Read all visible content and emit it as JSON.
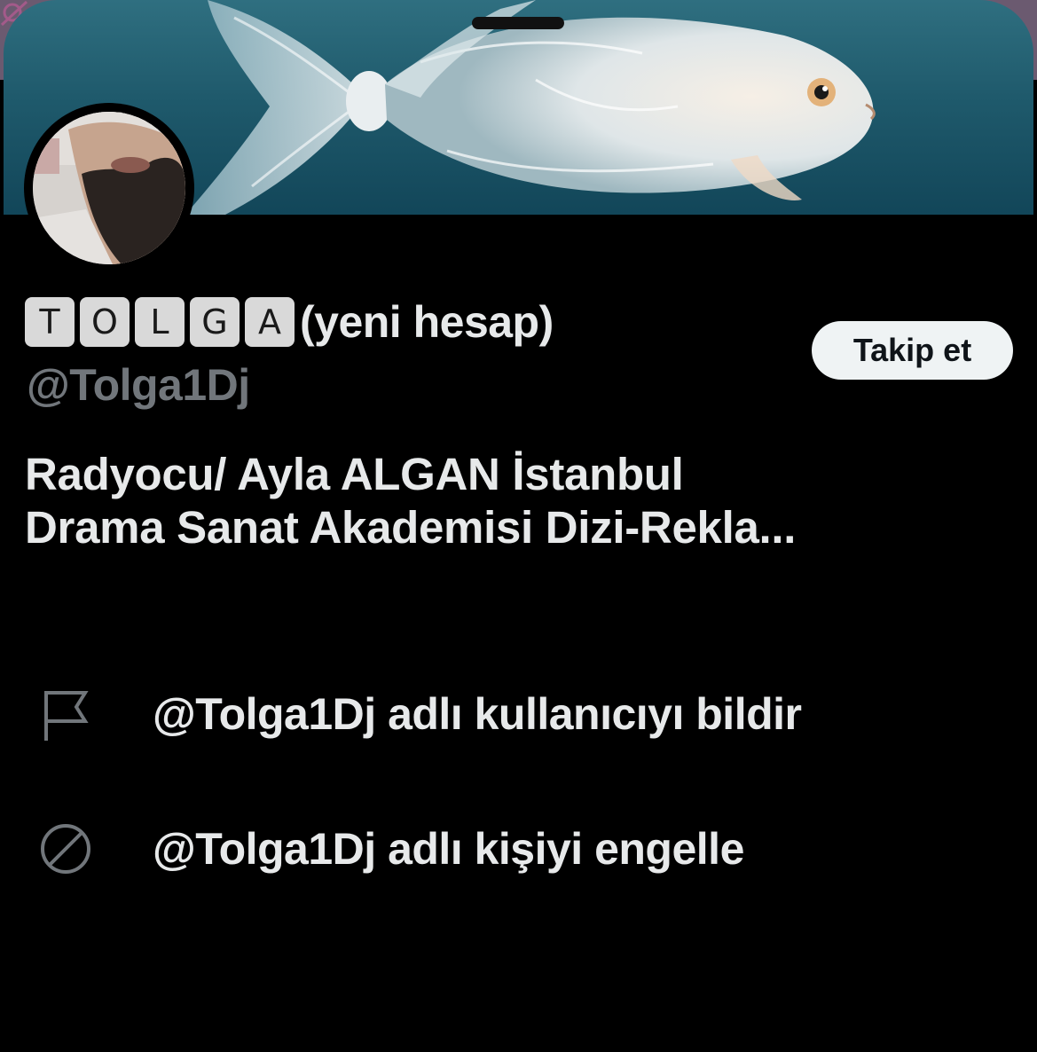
{
  "profile": {
    "name_letters": [
      "T",
      "O",
      "L",
      "G",
      "A"
    ],
    "name_suffix": "(yeni hesap)",
    "handle": "@Tolga1Dj",
    "bio_lines": [
      "Radyocu/ Ayla ALGAN İstanbul",
      "Drama Sanat Akademisi Dizi-Rekla..."
    ]
  },
  "follow_button": {
    "label": "Takip et"
  },
  "actions": [
    {
      "icon": "flag-icon",
      "label": "@Tolga1Dj adlı kullanıcıyı bildir"
    },
    {
      "icon": "block-icon",
      "label": "@Tolga1Dj adlı kişiyi engelle"
    }
  ],
  "colors": {
    "background": "#000000",
    "primary_text": "#e7e9ea",
    "secondary_text": "#71767b",
    "button_bg": "#eff3f4",
    "button_text": "#0f1419"
  }
}
